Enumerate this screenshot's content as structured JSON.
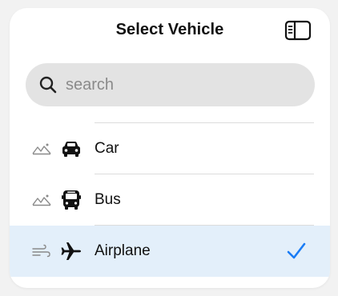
{
  "header": {
    "title": "Select Vehicle",
    "toggle_icon": "sidebar-left-icon"
  },
  "search": {
    "placeholder": "search",
    "value": "",
    "icon": "magnifying-glass-icon"
  },
  "vehicles": [
    {
      "label": "Car",
      "icon": "car-icon",
      "weather_icon": "mountains-icon",
      "selected": false
    },
    {
      "label": "Bus",
      "icon": "bus-icon",
      "weather_icon": "mountains-icon",
      "selected": false
    },
    {
      "label": "Airplane",
      "icon": "airplane-icon",
      "weather_icon": "wind-icon",
      "selected": true
    }
  ],
  "colors": {
    "accent": "#1a7cf5",
    "selected_row": "#e3effa",
    "search_bg": "#e3e3e3"
  }
}
